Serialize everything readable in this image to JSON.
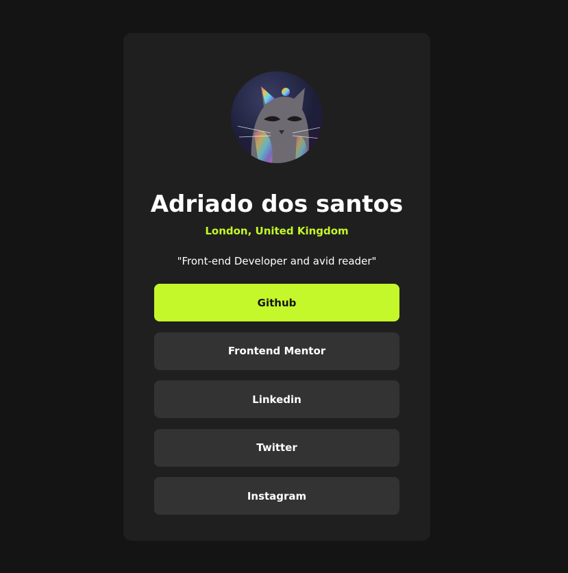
{
  "profile": {
    "name": "Adriado dos santos",
    "location": "London, United Kingdom",
    "bio": "\"Front-end Developer and avid reader\""
  },
  "links": [
    {
      "label": "Github",
      "active": true
    },
    {
      "label": "Frontend Mentor",
      "active": false
    },
    {
      "label": "Linkedin",
      "active": false
    },
    {
      "label": "Twitter",
      "active": false
    },
    {
      "label": "Instagram",
      "active": false
    }
  ],
  "colors": {
    "background": "#141414",
    "card": "#1f1f1f",
    "button": "#333333",
    "accent": "#c4f82a",
    "text": "#ffffff"
  }
}
